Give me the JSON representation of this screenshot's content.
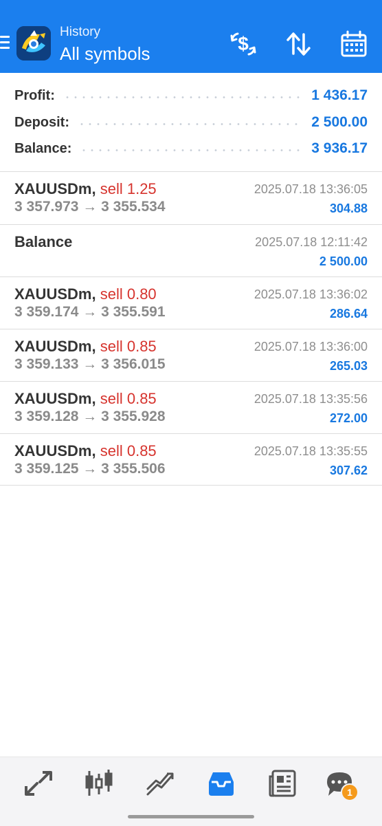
{
  "header": {
    "subtitle": "History",
    "title": "All symbols",
    "background": "#1b7fee",
    "icons": [
      "menu-icon",
      "app-logo",
      "dollar-sync-icon",
      "sort-icon",
      "calendar-icon"
    ]
  },
  "summary": {
    "profit_label": "Profit:",
    "profit_value": "1 436.17",
    "deposit_label": "Deposit:",
    "deposit_value": "2 500.00",
    "balance_label": "Balance:",
    "balance_value": "3 936.17"
  },
  "rows": [
    {
      "symbol": "XAUUSDm",
      "comma": ",",
      "side": "sell 1.25",
      "prices": "3 357.973 → 3 355.534",
      "time": "2025.07.18 13:36:05",
      "profit": "304.88"
    },
    {
      "symbol": "Balance",
      "comma": "",
      "side": "",
      "prices": "",
      "time": "2025.07.18 12:11:42",
      "profit": "2 500.00"
    },
    {
      "symbol": "XAUUSDm",
      "comma": ",",
      "side": "sell 0.80",
      "prices": "3 359.174 → 3 355.591",
      "time": "2025.07.18 13:36:02",
      "profit": "286.64"
    },
    {
      "symbol": "XAUUSDm",
      "comma": ",",
      "side": "sell 0.85",
      "prices": "3 359.133 → 3 356.015",
      "time": "2025.07.18 13:36:00",
      "profit": "265.03"
    },
    {
      "symbol": "XAUUSDm",
      "comma": ",",
      "side": "sell 0.85",
      "prices": "3 359.128 → 3 355.928",
      "time": "2025.07.18 13:35:56",
      "profit": "272.00"
    },
    {
      "symbol": "XAUUSDm",
      "comma": ",",
      "side": "sell 0.85",
      "prices": "3 359.125 → 3 355.506",
      "time": "2025.07.18 13:35:55",
      "profit": "307.62"
    }
  ],
  "colors": {
    "accent": "#1878e0",
    "sell": "#d6332d",
    "active_tab": "#1b7fee",
    "badge": "#f59a1c"
  },
  "bottom_nav": {
    "items": [
      "quotes-icon",
      "chart-icon",
      "trade-icon",
      "history-icon",
      "news-icon",
      "chat-icon"
    ],
    "active": "history-icon",
    "chat_badge": "1"
  }
}
